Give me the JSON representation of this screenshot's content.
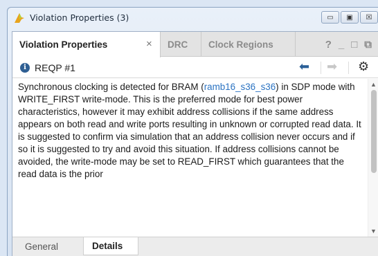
{
  "window": {
    "title": "Violation Properties (3)",
    "controls": {
      "minimize": "▭",
      "restore": "▣",
      "close": "☒"
    }
  },
  "tabs": [
    {
      "label": "Violation Properties",
      "close": "×"
    },
    {
      "label": "DRC"
    },
    {
      "label": "Clock Regions"
    }
  ],
  "tab_tools": {
    "help": "?",
    "minimize": "_",
    "maximize": "□",
    "float": "⧉"
  },
  "toolbar": {
    "violation_id": "REQP #1",
    "info_glyph": "i",
    "back_glyph": "⬅",
    "forward_glyph": "➡",
    "settings_glyph": "⚙"
  },
  "content": {
    "before_link": "Synchronous clocking is detected for BRAM (",
    "link": "ramb16_s36_s36",
    "after_link": ") in SDP mode with WRITE_FIRST write-mode. This is the preferred mode for best power characteristics, however it may exhibit address collisions if the same address appears on both read and write ports resulting in unknown or corrupted read data. It is suggested to confirm via simulation that an address collision never occurs and if so it is suggested to try and avoid this situation. If address collisions cannot be avoided, the write-mode may be set to READ_FIRST which guarantees that the read data is the prior"
  },
  "bottom_tabs": [
    {
      "label": "General"
    },
    {
      "label": "Details"
    }
  ],
  "colors": {
    "accent": "#2b73c2",
    "title_bg": "#dbe6f4"
  }
}
